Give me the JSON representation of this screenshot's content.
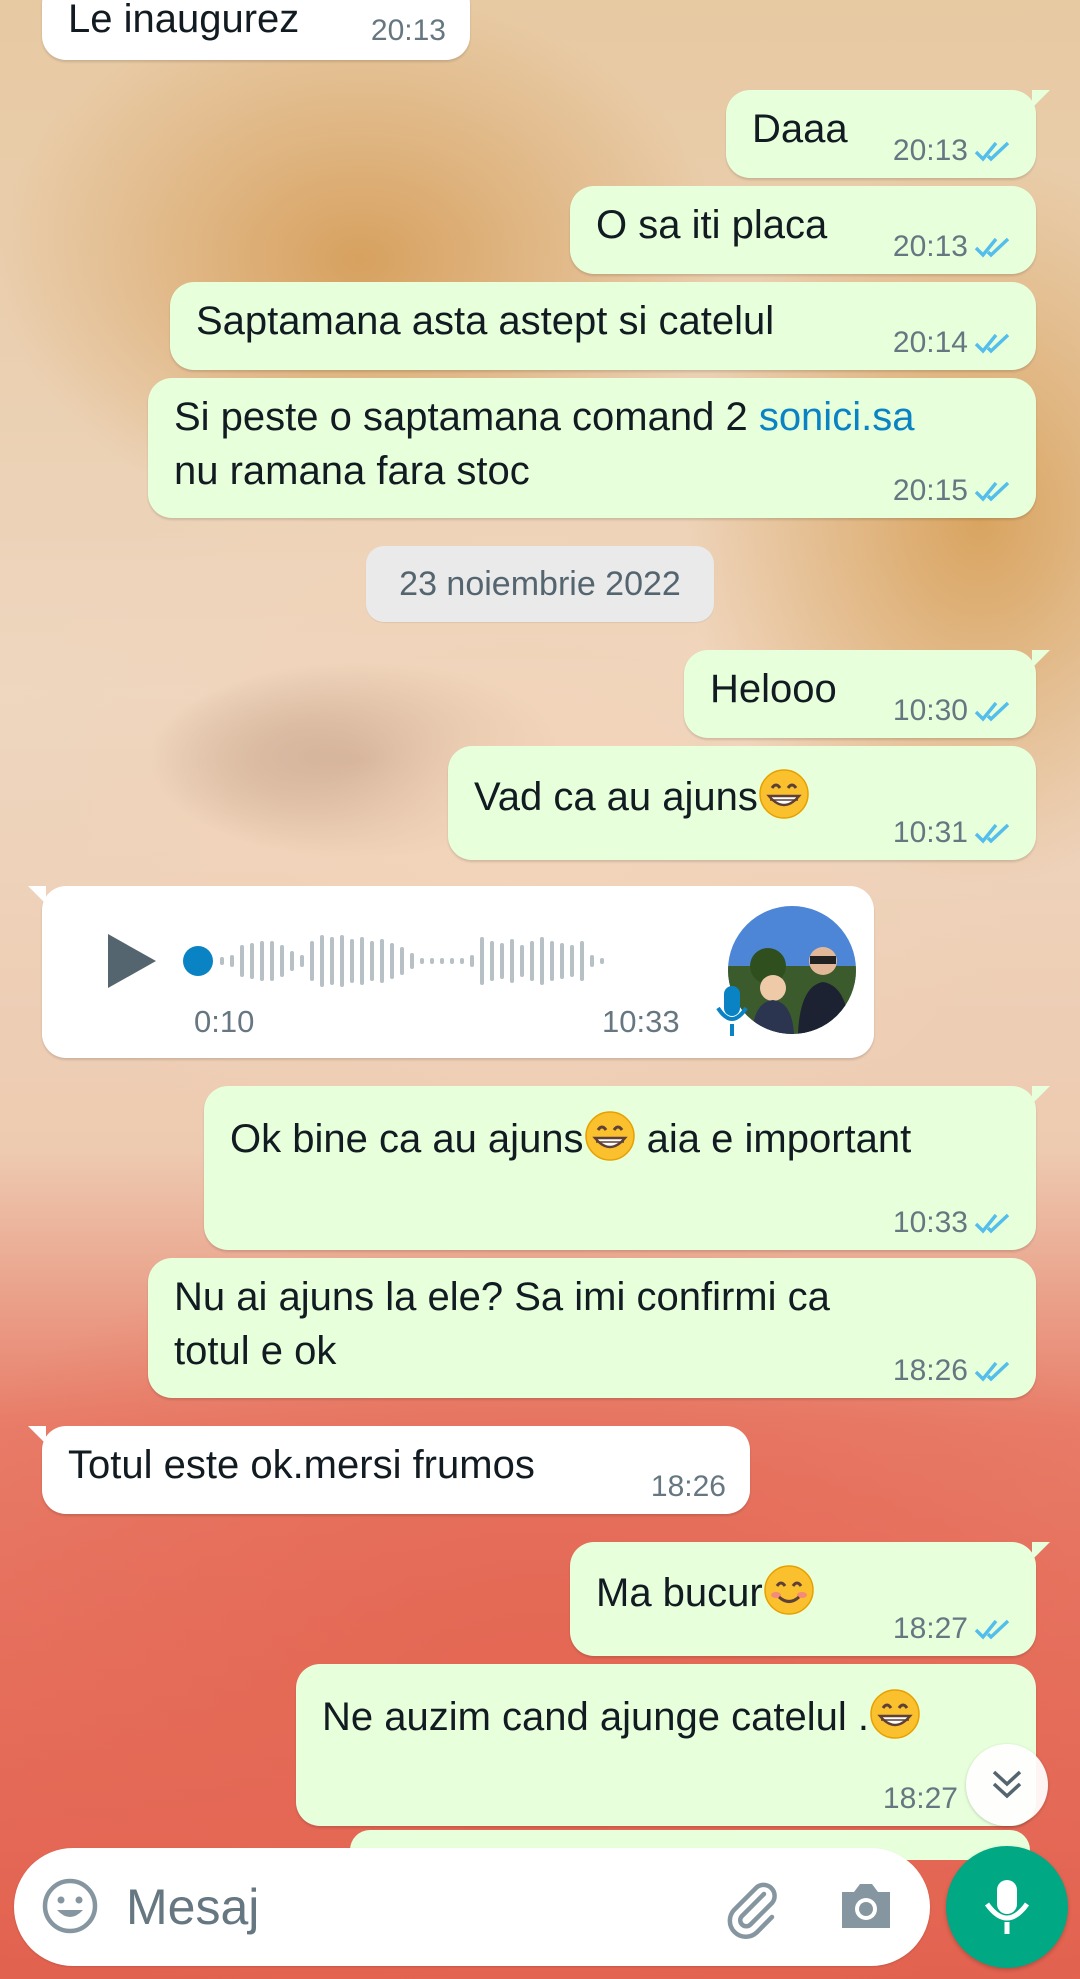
{
  "messages": [
    {
      "text": "Le inaugurez",
      "time": "20:13"
    },
    {
      "text": "Daaa",
      "time": "20:13"
    },
    {
      "text": "O sa iti placa",
      "time": "20:13"
    },
    {
      "text": "Saptamana asta astept si catelul",
      "time": "20:14"
    },
    {
      "text_before_link": "Si peste o saptamana comand 2 ",
      "link": "sonici.sa",
      "text_line2": "nu ramana fara stoc",
      "time": "20:15"
    },
    {
      "text": "Helooo",
      "time": "10:30"
    },
    {
      "text": "Vad ca au ajuns",
      "time": "10:31"
    },
    {
      "text_before_emoji": "Ok bine ca au ajuns",
      "text_after_emoji": " aia e important",
      "time": "10:33"
    },
    {
      "text_line1": "Nu ai ajuns la ele? Sa imi confirmi ca",
      "text_line2": "totul e ok",
      "time": "18:26"
    },
    {
      "text": "Totul este ok.mersi frumos",
      "time": "18:26"
    },
    {
      "text": "Ma bucur",
      "time": "18:27"
    },
    {
      "text": "Ne auzim cand ajunge catelul .",
      "time": "18:27"
    }
  ],
  "date_separator": "23 noiembrie 2022",
  "voice_note": {
    "duration": "0:10",
    "time": "10:33"
  },
  "composer": {
    "placeholder": "Mesaj"
  },
  "colors": {
    "outgoing_bubble": "#e7ffdb",
    "incoming_bubble": "#ffffff",
    "read_ticks": "#53bdeb",
    "accent": "#00a884",
    "link": "#0a83c4"
  },
  "icons": [
    "double-check-icon",
    "play-icon",
    "mic-icon",
    "emoji-icon",
    "attach-icon",
    "camera-icon",
    "chevron-double-down-icon",
    "grin-emoji",
    "smile-emoji"
  ]
}
